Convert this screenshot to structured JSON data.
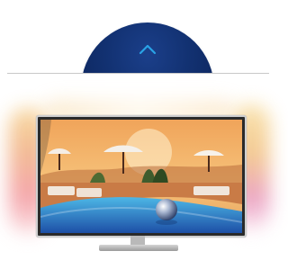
{
  "controls": {
    "collapse_button_icon": "chevron-up-icon",
    "accent_color": "#0f2a68",
    "chevron_color": "#29a3e6"
  },
  "product_image": {
    "scene": "tv-with-ambilight-resort-pool-scene",
    "ambilight_colors": [
      "#f7d79a",
      "#f2b78f",
      "#f4a1a7",
      "#eaa0c2"
    ]
  }
}
